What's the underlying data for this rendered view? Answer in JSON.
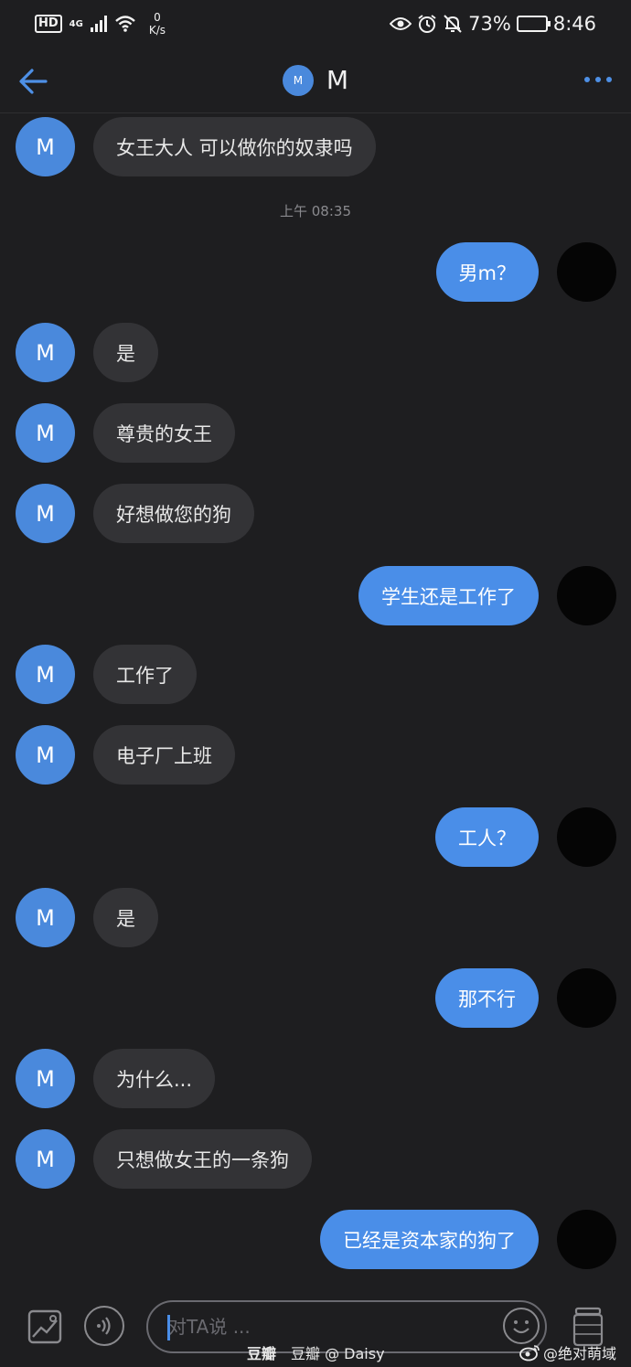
{
  "status_bar": {
    "hd": "HD",
    "network": "4G",
    "speed_value": "0",
    "speed_unit": "K/s",
    "battery_percent": "73%",
    "battery_level": 0.73,
    "time": "8:46"
  },
  "header": {
    "avatar_letter": "M",
    "title": "M"
  },
  "chat": {
    "timestamp": "上午 08:35",
    "avatar_letter": "M",
    "messages": [
      {
        "side": "in",
        "text": "女王大人 可以做你的奴隶吗"
      },
      {
        "side": "out",
        "text": "男m？"
      },
      {
        "side": "in",
        "text": "是"
      },
      {
        "side": "in",
        "text": "尊贵的女王"
      },
      {
        "side": "in",
        "text": "好想做您的狗"
      },
      {
        "side": "out",
        "text": "学生还是工作了"
      },
      {
        "side": "in",
        "text": "工作了"
      },
      {
        "side": "in",
        "text": "电子厂上班"
      },
      {
        "side": "out",
        "text": "工人？"
      },
      {
        "side": "in",
        "text": "是"
      },
      {
        "side": "out",
        "text": "那不行"
      },
      {
        "side": "in",
        "text": "为什么..."
      },
      {
        "side": "in",
        "text": "只想做女王的一条狗"
      },
      {
        "side": "out",
        "text": "已经是资本家的狗了"
      }
    ]
  },
  "input_bar": {
    "placeholder": "对TA说 ..."
  },
  "watermark": {
    "douban": "豆瓣",
    "douban_user": "豆瓣 @ Daisy",
    "weibo_user": "@绝对萌域"
  },
  "colors": {
    "accent": "#4a8ee8",
    "avatar": "#4a89dc",
    "background": "#1e1e20",
    "bubble_in": "#333336"
  }
}
